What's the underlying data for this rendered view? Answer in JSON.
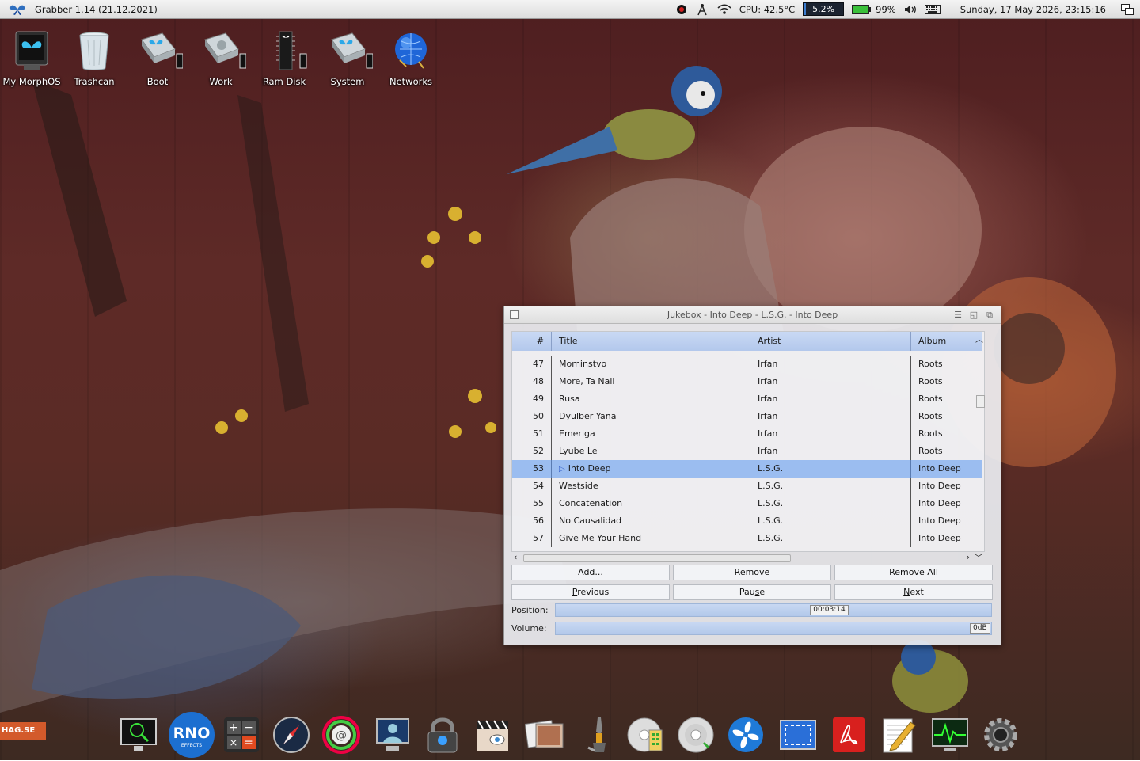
{
  "menubar": {
    "app_title": "Grabber 1.14 (21.12.2021)",
    "cpu_temp": "CPU: 42.5°C",
    "cpu_load": "5.2%",
    "cpu_load_fraction": 0.052,
    "battery": "99%",
    "battery_fraction": 0.99,
    "clock": "Sunday, 17 May 2026, 23:15:16",
    "icons": [
      "record-icon",
      "antenna-icon",
      "wifi-icon",
      "speaker-icon",
      "keyboard-icon",
      "screens-icon"
    ]
  },
  "desktop_icons": [
    {
      "label": "My MorphOS",
      "icon": "morphos-monitor-icon"
    },
    {
      "label": "Trashcan",
      "icon": "trashcan-icon"
    },
    {
      "label": "Boot",
      "icon": "drive-icon"
    },
    {
      "label": "Work",
      "icon": "drive-icon"
    },
    {
      "label": "Ram Disk",
      "icon": "ramdisk-icon"
    },
    {
      "label": "System",
      "icon": "drive-icon"
    },
    {
      "label": "Networks",
      "icon": "globe-icon"
    }
  ],
  "jukebox": {
    "window_title": "Jukebox - Into Deep - L.S.G. - Into Deep",
    "columns": {
      "num": "#",
      "title": "Title",
      "artist": "Artist",
      "album": "Album"
    },
    "tracks": [
      {
        "num": "47",
        "title": "Mominstvo",
        "artist": "Irfan",
        "album": "Roots"
      },
      {
        "num": "48",
        "title": "More, Ta Nali",
        "artist": "Irfan",
        "album": "Roots"
      },
      {
        "num": "49",
        "title": "Rusa",
        "artist": "Irfan",
        "album": "Roots"
      },
      {
        "num": "50",
        "title": "Dyulber Yana",
        "artist": "Irfan",
        "album": "Roots"
      },
      {
        "num": "51",
        "title": "Emeriga",
        "artist": "Irfan",
        "album": "Roots"
      },
      {
        "num": "52",
        "title": "Lyube Le",
        "artist": "Irfan",
        "album": "Roots"
      },
      {
        "num": "53",
        "title": "Into Deep",
        "artist": "L.S.G.",
        "album": "Into Deep",
        "playing": true
      },
      {
        "num": "54",
        "title": "Westside",
        "artist": "L.S.G.",
        "album": "Into Deep"
      },
      {
        "num": "55",
        "title": "Concatenation",
        "artist": "L.S.G.",
        "album": "Into Deep"
      },
      {
        "num": "56",
        "title": "No Causalidad",
        "artist": "L.S.G.",
        "album": "Into Deep"
      },
      {
        "num": "57",
        "title": "Give Me Your Hand",
        "artist": "L.S.G.",
        "album": "Into Deep"
      }
    ],
    "buttons": {
      "add": "Add...",
      "remove": "Remove",
      "remove_all": "Remove All",
      "previous": "Previous",
      "pause": "Pause",
      "next": "Next"
    },
    "position_label": "Position:",
    "position_value": "00:03:14",
    "position_fraction": 0.64,
    "volume_label": "Volume:",
    "volume_value": "0dB",
    "volume_fraction": 1.0
  },
  "dock": {
    "watermark": "HAG.SE",
    "items": [
      {
        "name": "screen-magnifier-icon"
      },
      {
        "name": "rno-effects-icon",
        "text": "RNO",
        "subtext": "EFFECTS"
      },
      {
        "name": "calculator-icon"
      },
      {
        "name": "compass-browser-icon"
      },
      {
        "name": "email-client-icon"
      },
      {
        "name": "remote-desktop-icon"
      },
      {
        "name": "padlock-icon"
      },
      {
        "name": "media-player-icon"
      },
      {
        "name": "image-viewer-icon"
      },
      {
        "name": "robot-arm-icon"
      },
      {
        "name": "cd-burner-icon"
      },
      {
        "name": "cd-player-icon"
      },
      {
        "name": "fan-icon"
      },
      {
        "name": "screen-grabber-icon"
      },
      {
        "name": "pdf-icon"
      },
      {
        "name": "text-editor-icon"
      },
      {
        "name": "system-monitor-icon"
      },
      {
        "name": "settings-gear-icon"
      }
    ]
  },
  "colors": {
    "selection": "#9bbdf0",
    "header": "#c0d3f0",
    "accent": "#3b7dd0"
  }
}
